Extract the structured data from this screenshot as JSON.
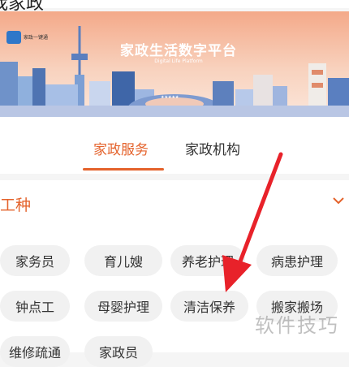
{
  "header": {
    "title": "我家政"
  },
  "banner": {
    "logo_text": "家政一键通",
    "title": "家政生活数字平台",
    "subtitle": "Digital Life Platform",
    "sign_text": "★★★★★"
  },
  "tabs": [
    {
      "label": "家政服务",
      "active": true
    },
    {
      "label": "家政机构",
      "active": false
    }
  ],
  "section": {
    "title": "工种"
  },
  "chips": [
    {
      "label": "家务员"
    },
    {
      "label": "育儿嫂"
    },
    {
      "label": "养老护理"
    },
    {
      "label": "病患护理"
    },
    {
      "label": "钟点工"
    },
    {
      "label": "母婴护理"
    },
    {
      "label": "清洁保养"
    },
    {
      "label": "搬家搬场"
    },
    {
      "label": "维修疏通"
    },
    {
      "label": "家政员"
    }
  ],
  "watermark": "软件技巧",
  "colors": {
    "accent": "#e4622b",
    "arrow": "#e8222a",
    "chip_bg": "#f1f1f1"
  }
}
